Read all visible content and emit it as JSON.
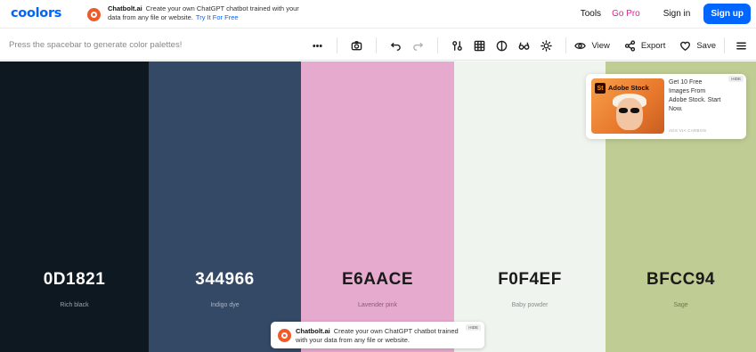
{
  "header": {
    "logo": "coolors",
    "promo": {
      "brand": "Chatbolt.ai",
      "text": "Create your own ChatGPT chatbot trained with your data from any file or website.",
      "link": "Try It For Free"
    },
    "nav": {
      "tools": "Tools",
      "gopro": "Go Pro",
      "signin": "Sign in",
      "signup": "Sign up"
    }
  },
  "toolbar": {
    "hint": "Press the spacebar to generate color palettes!",
    "view_label": "View",
    "export_label": "Export",
    "save_label": "Save",
    "icons": [
      "more-icon",
      "camera-icon",
      "undo-icon",
      "redo-icon",
      "adjust-icon",
      "grid-icon",
      "contrast-icon",
      "glasses-icon",
      "brightness-icon",
      "eye-icon",
      "share-icon",
      "heart-icon",
      "menu-icon"
    ]
  },
  "palette": [
    {
      "hex": "0D1821",
      "name": "Rich black",
      "bg": "#0d1821",
      "fg": "#ffffff",
      "name_color": "#9aa3ab"
    },
    {
      "hex": "344966",
      "name": "Indigo dye",
      "bg": "#344966",
      "fg": "#ffffff",
      "name_color": "#aab4c4"
    },
    {
      "hex": "E6AACE",
      "name": "Lavender pink",
      "bg": "#e6aace",
      "fg": "#1a1a1a",
      "name_color": "#8a5a78"
    },
    {
      "hex": "F0F4EF",
      "name": "Baby powder",
      "bg": "#f0f4ef",
      "fg": "#1a1a1a",
      "name_color": "#8a8e8a"
    },
    {
      "hex": "BFCC94",
      "name": "Sage",
      "bg": "#bfcc94",
      "fg": "#1a1a1a",
      "name_color": "#6e7a4a"
    }
  ],
  "side_ad": {
    "brand": "Adobe Stock",
    "logo_mark": "St",
    "copy": "Get 10 Free Images From Adobe Stock. Start Now.",
    "via": "ADS VIA CARBON",
    "hide": "HIDE"
  },
  "bottom_ad": {
    "brand": "Chatbolt.ai",
    "text": "Create your own ChatGPT chatbot trained with your data from any file or website.",
    "hide": "HIDE"
  },
  "colors": {
    "accent": "#0066ff",
    "gopro": "#e0218a",
    "chatbolt": "#f05a28"
  }
}
